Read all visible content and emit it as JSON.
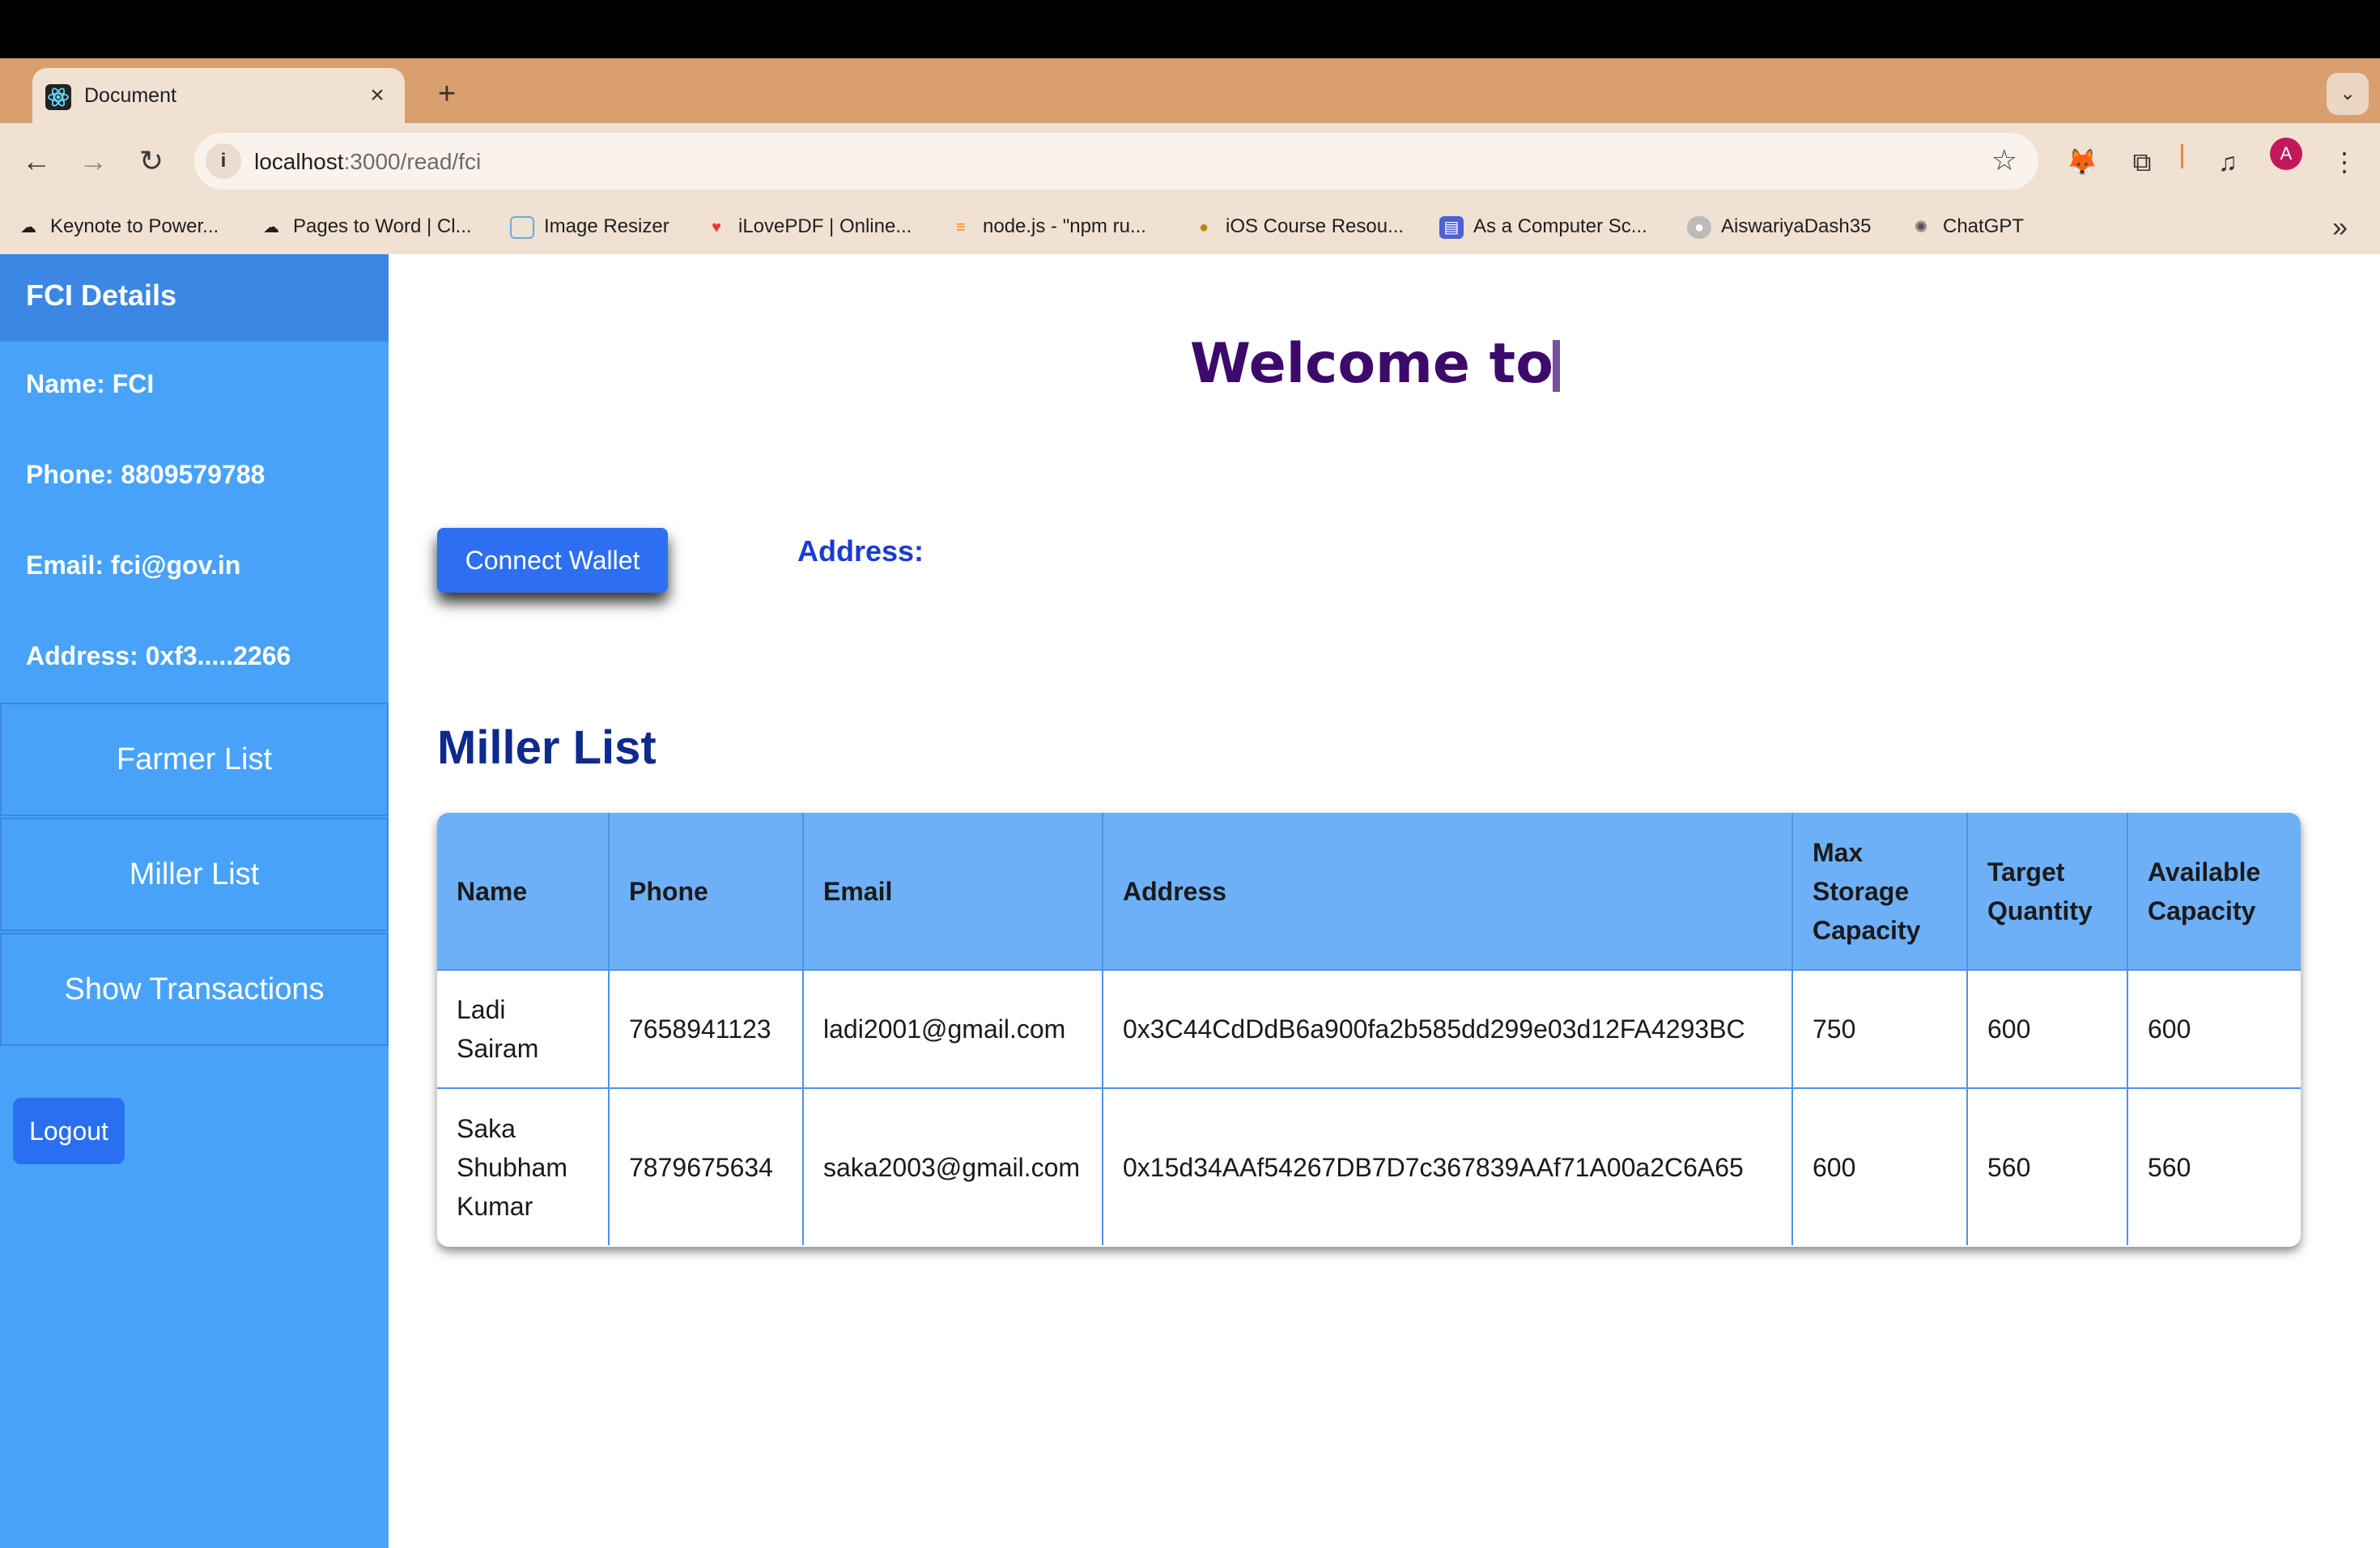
{
  "browser": {
    "tab_title": "Document",
    "tab_close": "×",
    "new_tab": "+",
    "url_host": "localhost",
    "url_path": ":3000/read/fci",
    "profile_initial": "A",
    "bookmarks": [
      {
        "label": "Keynote to Power...",
        "icon": "cloud-icon"
      },
      {
        "label": "Pages to Word | Cl...",
        "icon": "cloud-icon"
      },
      {
        "label": "Image Resizer",
        "icon": "image-icon"
      },
      {
        "label": "iLovePDF | Online...",
        "icon": "heart-icon"
      },
      {
        "label": "node.js - \"npm ru...",
        "icon": "stackoverflow-icon"
      },
      {
        "label": "iOS Course Resou...",
        "icon": "course-icon"
      },
      {
        "label": "As a Computer Sc...",
        "icon": "printer-icon"
      },
      {
        "label": "AiswariyaDash35",
        "icon": "github-icon"
      },
      {
        "label": "ChatGPT",
        "icon": "chatgpt-icon"
      }
    ],
    "bookmarks_more": "»"
  },
  "sidebar": {
    "title": "FCI Details",
    "name": "Name: FCI",
    "phone": "Phone: 8809579788",
    "email": "Email: fci@gov.in",
    "address": "Address: 0xf3.....2266",
    "buttons": [
      "Farmer List",
      "Miller List",
      "Show Transactions"
    ],
    "logout": "Logout"
  },
  "main": {
    "welcome": "Welcome to",
    "connect_wallet": "Connect Wallet",
    "address_label": "Address:",
    "section_title": "Miller List",
    "table": {
      "headers": [
        [
          "Name"
        ],
        [
          "Phone"
        ],
        [
          "Email"
        ],
        [
          "Address"
        ],
        [
          "Max",
          "Storage",
          "Capacity"
        ],
        [
          "Target",
          "Quantity"
        ],
        [
          "Available",
          "Capacity"
        ]
      ],
      "rows": [
        {
          "name": [
            "Ladi",
            "Sairam"
          ],
          "phone": "7658941123",
          "email": "ladi2001@gmail.com",
          "address": "0x3C44CdDdB6a900fa2b585dd299e03d12FA4293BC",
          "max_storage": "750",
          "target_quantity": "600",
          "available_capacity": "600"
        },
        {
          "name": [
            "Saka",
            "Shubham",
            "Kumar"
          ],
          "phone": "7879675634",
          "email": "saka2003@gmail.com",
          "address": "0x15d34AAf54267DB7D7c367839AAf71A00a2C6A65",
          "max_storage": "600",
          "target_quantity": "560",
          "available_capacity": "560"
        }
      ]
    }
  },
  "colors": {
    "sidebar": "#48a3f8",
    "sidebar_header": "#3b87e3",
    "button_blue": "#2d6ff0",
    "welcome_purple": "#3b0a6b",
    "table_header": "#6eb0f8"
  }
}
